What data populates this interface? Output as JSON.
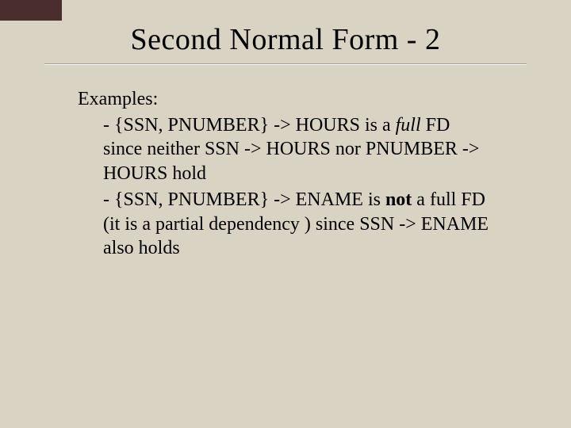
{
  "title": "Second Normal Form - 2",
  "examples_label": "Examples:",
  "ex1": {
    "dash": "- ",
    "lead": "{SSN, PNUMBER} -> HOURS is a ",
    "full": "full",
    "tail1": " FD since neither SSN -> HOURS nor PNUMBER -> HOURS hold"
  },
  "ex2": {
    "dash": "- ",
    "lead": "{SSN, PNUMBER} -> ENAME is ",
    "not": "not",
    "tail1": " a full FD (it is a partial dependency ) since SSN -> ENAME also holds"
  }
}
